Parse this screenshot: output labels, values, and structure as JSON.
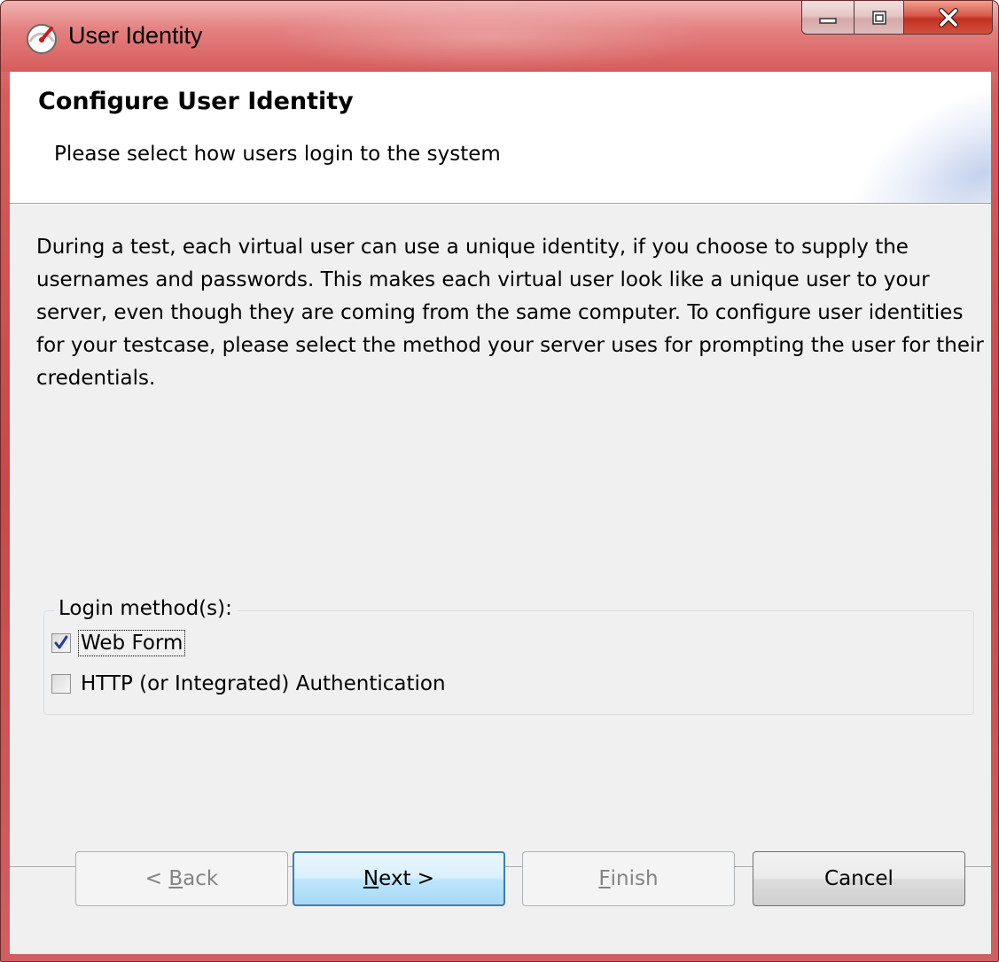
{
  "window": {
    "title": "User Identity",
    "controls": {
      "minimize_icon": "minimize-icon",
      "maximize_icon": "maximize-icon",
      "close_icon": "close-icon"
    }
  },
  "header": {
    "title": "Configure User Identity",
    "subtitle": "Please select how users login to the system"
  },
  "body": {
    "description": "During a test, each virtual user can use a unique identity, if you choose to supply the usernames and passwords. This makes each virtual user look like a unique user to your server, even though they are coming from the same computer. To configure user identities for your testcase, please select the method your server uses for prompting the user for their credentials."
  },
  "login_methods": {
    "legend": "Login method(s):",
    "options": [
      {
        "label": "Web Form",
        "checked": true
      },
      {
        "label": "HTTP (or Integrated) Authentication",
        "checked": false
      }
    ]
  },
  "buttons": {
    "back": {
      "prefix": "< ",
      "mnemonic": "B",
      "rest": "ack",
      "enabled": false
    },
    "next": {
      "prefix": "",
      "mnemonic": "N",
      "rest": "ext >",
      "enabled": true
    },
    "finish": {
      "prefix": "",
      "mnemonic": "F",
      "rest": "inish",
      "enabled": false
    },
    "cancel": {
      "label": "Cancel",
      "enabled": true
    }
  },
  "colors": {
    "title_bar": "#d65c5c",
    "client_bg": "#f0f0f0",
    "default_button_border": "#3c7fb1",
    "checkmark": "#2a3d8f"
  }
}
